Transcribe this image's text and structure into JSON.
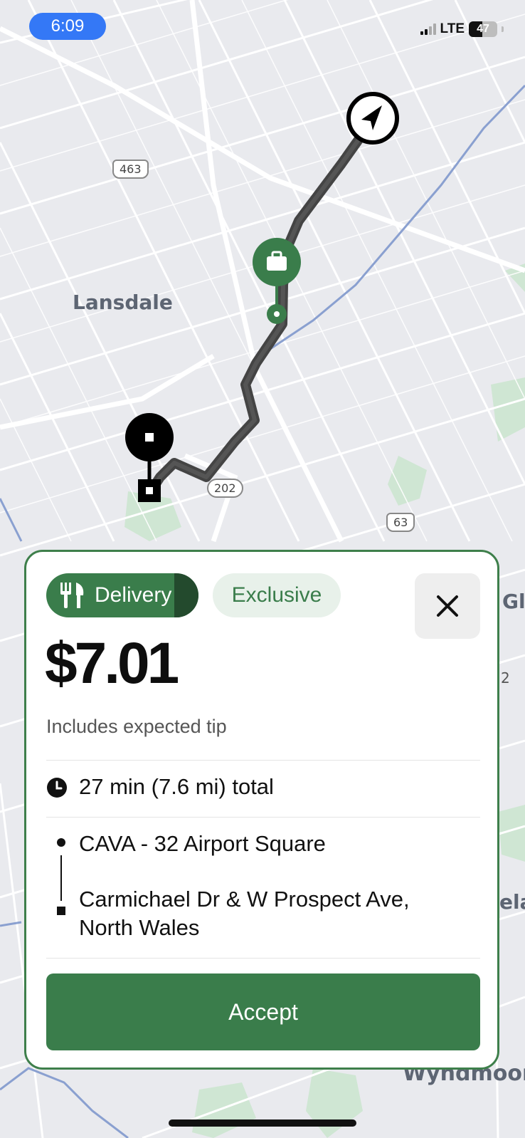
{
  "status_bar": {
    "time": "6:09",
    "network": "LTE",
    "battery": "47",
    "battery_level": 0.47
  },
  "map": {
    "town_label": "Lansdale",
    "shields": {
      "pa463": "463",
      "us202": "202",
      "pa63": "63"
    },
    "edge_fragments": {
      "right_g": "Gl",
      "right_2": "2",
      "right_ela": "ela",
      "bottom_town": "Wyndmoor"
    }
  },
  "card": {
    "tags": {
      "delivery": "Delivery",
      "exclusive": "Exclusive"
    },
    "price": "$7.01",
    "tip_note": "Includes expected tip",
    "trip_summary": "27 min (7.6 mi) total",
    "pickup": "CAVA - 32 Airport Square",
    "dropoff_line1": "Carmichael Dr & W Prospect Ave,",
    "dropoff_line2": "North Wales",
    "accept_label": "Accept"
  },
  "colors": {
    "accent": "#3a7d4b",
    "accent_light": "#e8f1ea",
    "route": "#3a3a3a",
    "water": "#8aa0d0",
    "park": "#cfe6d3"
  },
  "icons": [
    "navigation-arrow-icon",
    "bag-icon",
    "utensils-icon",
    "close-icon",
    "clock-icon"
  ]
}
